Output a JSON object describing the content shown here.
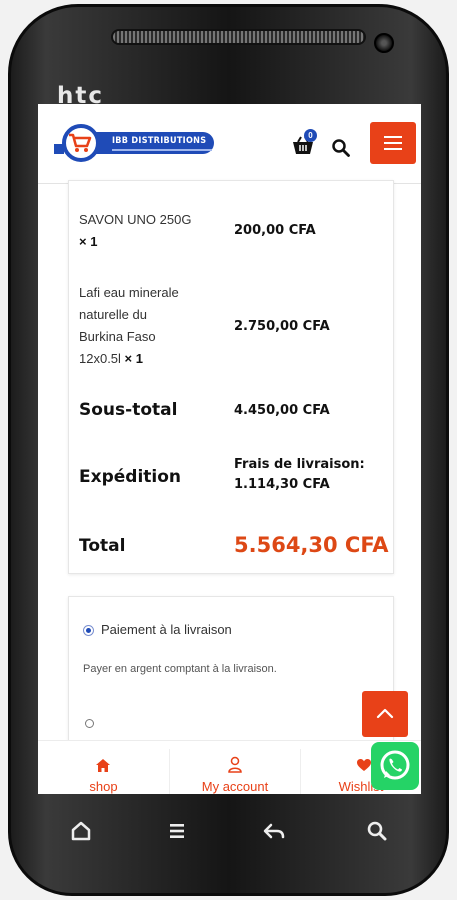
{
  "device": {
    "brand": "htc"
  },
  "header": {
    "logo_text": "IBB DISTRIBUTIONS",
    "cart_count": "0"
  },
  "order": {
    "items": [
      {
        "name_lines": [
          "SAVON UNO 250G"
        ],
        "qty": "× 1",
        "price": "200,00 CFA"
      },
      {
        "name_lines": [
          "Lafi eau minerale",
          "naturelle du",
          "Burkina Faso",
          "12x0.5l"
        ],
        "qty": "× 1",
        "price": "2.750,00 CFA"
      }
    ],
    "subtotal_label": "Sous-total",
    "subtotal_value": "4.450,00 CFA",
    "shipping_label": "Expédition",
    "shipping_value_line1": "Frais de livraison:",
    "shipping_value_line2": "1.114,30 CFA",
    "total_label": "Total",
    "total_value": "5.564,30 CFA"
  },
  "payment": {
    "method_label": "Paiement à la livraison",
    "method_description": "Payer en argent comptant à la livraison."
  },
  "bottom_nav": {
    "items": [
      {
        "label": "shop",
        "icon": "home-icon"
      },
      {
        "label": "My account",
        "icon": "user-icon"
      },
      {
        "label": "Wishlist",
        "icon": "heart-icon"
      }
    ]
  },
  "colors": {
    "accent": "#e84118",
    "brand_blue": "#1f4bb7",
    "total": "#dd4815",
    "whatsapp": "#25d366"
  }
}
